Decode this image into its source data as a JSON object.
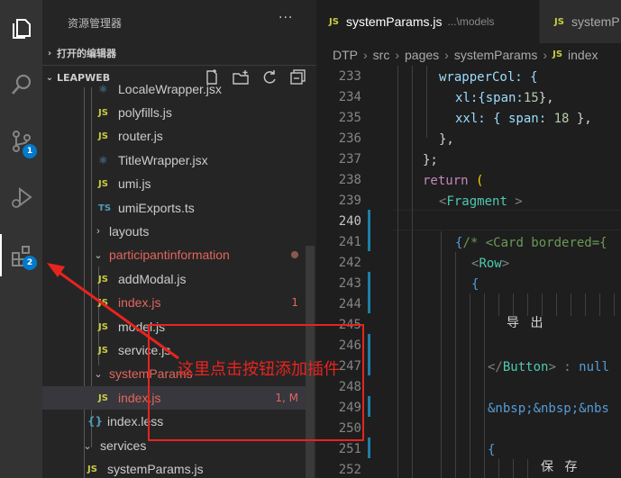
{
  "sidebar": {
    "title": "资源管理器",
    "more": "···",
    "open_editors": "打开的编辑器",
    "project": "LEAPWEB",
    "tree": [
      {
        "name": "LocaleWrapper.jsx",
        "icon": "⚛",
        "type": "react"
      },
      {
        "name": "polyfills.js",
        "icon": "JS",
        "type": "js"
      },
      {
        "name": "router.js",
        "icon": "JS",
        "type": "js"
      },
      {
        "name": "TitleWrapper.jsx",
        "icon": "⚛",
        "type": "react"
      },
      {
        "name": "umi.js",
        "icon": "JS",
        "type": "js"
      },
      {
        "name": "umiExports.ts",
        "icon": "TS",
        "type": "ts"
      },
      {
        "name": "layouts",
        "chevron": "›",
        "type": "folder"
      },
      {
        "name": "participantinformation",
        "chevron": "⌄",
        "type": "folder-mod"
      },
      {
        "name": "addModal.js",
        "icon": "JS",
        "type": "js"
      },
      {
        "name": "index.js",
        "icon": "JS",
        "type": "js-mod",
        "badge": "1"
      },
      {
        "name": "model.js",
        "icon": "JS",
        "type": "js"
      },
      {
        "name": "service.js",
        "icon": "JS",
        "type": "js"
      },
      {
        "name": "systemParams",
        "chevron": "⌄",
        "type": "folder-mod"
      },
      {
        "name": "index.js",
        "icon": "JS",
        "type": "js-mod",
        "badge": "1, M"
      },
      {
        "name": "index.less",
        "icon": "{}",
        "type": "css"
      },
      {
        "name": "services",
        "chevron": "⌄",
        "type": "folder"
      },
      {
        "name": "systemParams.js",
        "icon": "JS",
        "type": "js"
      }
    ]
  },
  "activity": {
    "scm_badge": "1",
    "ext_badge": "2"
  },
  "editor": {
    "tab1": {
      "icon": "JS",
      "name": "systemParams.js",
      "path": "...\\models"
    },
    "tab2": {
      "icon": "JS",
      "name": "systemP"
    },
    "breadcrumb": [
      "DTP",
      "src",
      "pages",
      "systemParams"
    ],
    "breadcrumb_file_icon": "JS",
    "breadcrumb_file": "index",
    "line_numbers": [
      "233",
      "234",
      "235",
      "236",
      "237",
      "238",
      "239",
      "240",
      "241",
      "242",
      "243",
      "244",
      "245",
      "246",
      "247",
      "248",
      "249",
      "250",
      "251",
      "252"
    ],
    "code": {
      "l233": "wrapperCol: {",
      "l234a": "xl:{span:",
      "l234b": "15",
      "l234c": "},",
      "l235a": "xxl: { span: ",
      "l235b": "18",
      "l235c": " },",
      "l236": "},",
      "l237": "};",
      "l238a": "return ",
      "l238b": "(",
      "l239a": "<",
      "l239b": "Fragment",
      "l239c": " >",
      "l241a": "{",
      "l241b": "/* <Card bordered={",
      "l242a": "<",
      "l242b": "Row",
      "l242c": ">",
      "l243": "{",
      "l245": "导 出",
      "l246a": "</",
      "l246b": "Button",
      "l246c": "> : ",
      "l246d": "null",
      "l248": "&nbsp;&nbsp;&nbs",
      "l250": "{",
      "l252": "保 存"
    }
  },
  "annotation": {
    "text": "这里点击按钮添加插件",
    "color": "#e8241e"
  }
}
